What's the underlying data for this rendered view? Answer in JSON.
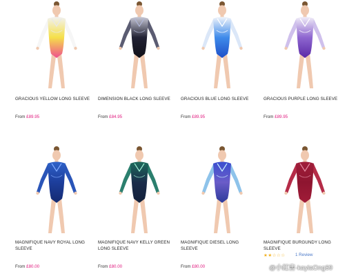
{
  "products": [
    {
      "name": "GRACIOUS YELLOW LONG SLEEVE",
      "price_prefix": "From",
      "price": "£89.95",
      "colors": {
        "top": "#f2f2f2",
        "mid": "#f5e04a",
        "bottom": "#ef4f8e",
        "sleeve": "#f6f6f6",
        "accent": "#e8e8e8"
      }
    },
    {
      "name": "DIMENSION BLACK LONG SLEEVE",
      "price_prefix": "From",
      "price": "£84.95",
      "colors": {
        "top": "#c8c9d6",
        "mid": "#222234",
        "bottom": "#111118",
        "sleeve": "#5b5c72",
        "accent": "#b0b6d6"
      }
    },
    {
      "name": "GRACIOUS BLUE LONG SLEEVE",
      "price_prefix": "From",
      "price": "£89.95",
      "colors": {
        "top": "#f0f4fb",
        "mid": "#3f8bea",
        "bottom": "#1e4fc8",
        "sleeve": "#dbe7f8",
        "accent": "#ffffff"
      }
    },
    {
      "name": "GRACIOUS PURPLE LONG SLEEVE",
      "price_prefix": "From",
      "price": "£89.95",
      "colors": {
        "top": "#f1eef8",
        "mid": "#8e66d0",
        "bottom": "#5a2aa6",
        "sleeve": "#cfc0ec",
        "accent": "#ffffff"
      }
    },
    {
      "name": "MAGNIFIQUE NAVY ROYAL LONG SLEEVE",
      "price_prefix": "From",
      "price": "£80.00",
      "colors": {
        "top": "#2f62c9",
        "mid": "#1d3e9c",
        "bottom": "#142a70",
        "sleeve": "#2a55b8",
        "accent": "#7fa9ff"
      }
    },
    {
      "name": "MAGNIFIQUE NAVY KELLY GREEN LONG SLEEVE",
      "price_prefix": "From",
      "price": "£80.00",
      "colors": {
        "top": "#1e6a5c",
        "mid": "#1a2c4a",
        "bottom": "#12203a",
        "sleeve": "#2b7f6e",
        "accent": "#9ff0d4"
      }
    },
    {
      "name": "MAGNIFIQUE DIESEL LONG SLEEVE",
      "price_prefix": "From",
      "price": "£80.00",
      "colors": {
        "top": "#3b4fd0",
        "mid": "#6a5cc8",
        "bottom": "#2c3a9a",
        "sleeve": "#8ec3ea",
        "accent": "#c9f1ff"
      }
    },
    {
      "name": "MAGNIFIQUE BURGUNDY LONG SLEEVE",
      "price_prefix": "",
      "price": "",
      "rating": "★★☆☆☆",
      "review_text": "1 Review",
      "colors": {
        "top": "#a01e3a",
        "mid": "#8e1530",
        "bottom": "#a11c38",
        "sleeve": "#b52c48",
        "accent": "#e38aa0"
      }
    }
  ],
  "watermark": "@小紅書·kaylaOng69"
}
